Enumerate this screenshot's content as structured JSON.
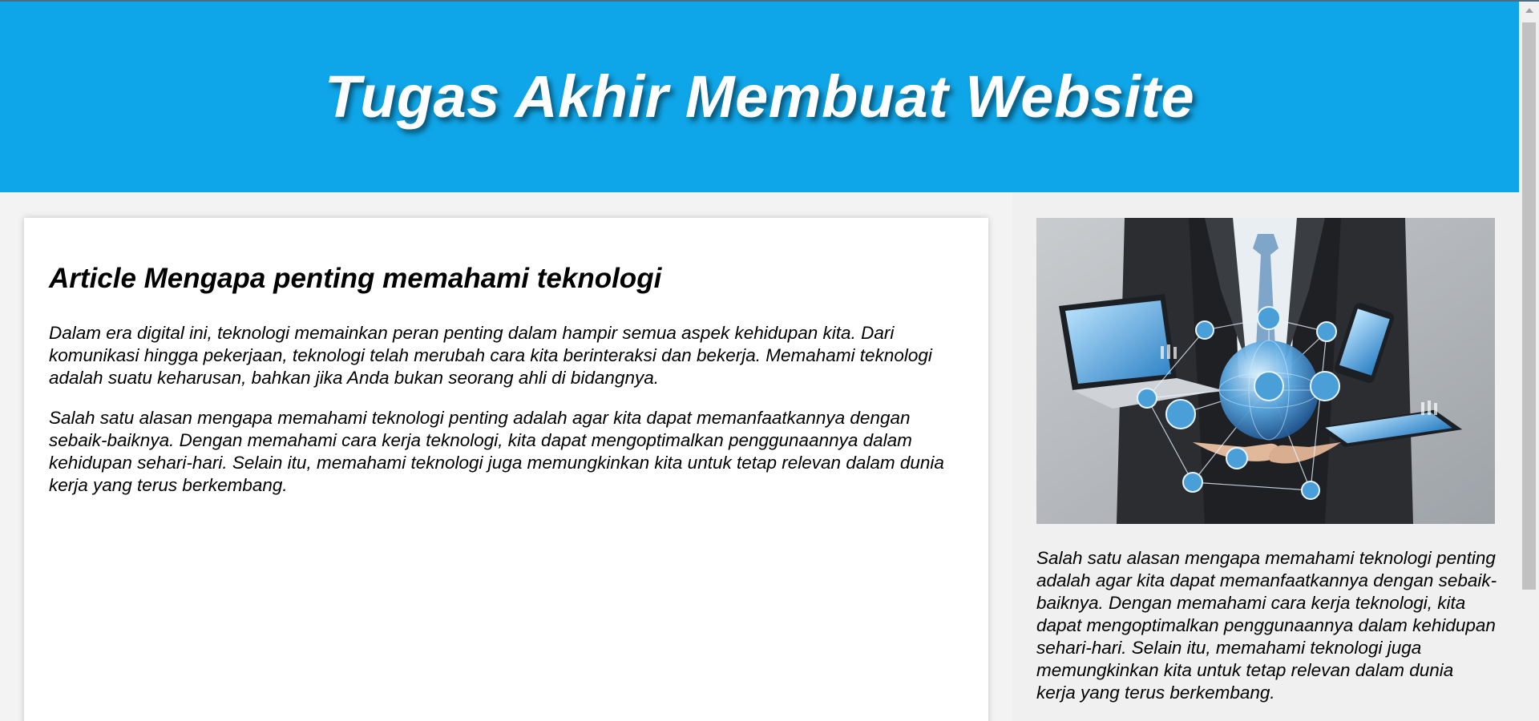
{
  "header": {
    "title": "Tugas Akhir Membuat Website"
  },
  "article": {
    "heading": "Article Mengapa penting memahami teknologi",
    "paragraphs": [
      "Dalam era digital ini, teknologi memainkan peran penting dalam hampir semua aspek kehidupan kita. Dari komunikasi hingga pekerjaan, teknologi telah merubah cara kita berinteraksi dan bekerja. Memahami teknologi adalah suatu keharusan, bahkan jika Anda bukan seorang ahli di bidangnya.",
      "Salah satu alasan mengapa memahami teknologi penting adalah agar kita dapat memanfaatkannya dengan sebaik-baiknya. Dengan memahami cara kerja teknologi, kita dapat mengoptimalkan penggunaannya dalam kehidupan sehari-hari. Selain itu, memahami teknologi juga memungkinkan kita untuk tetap relevan dalam dunia kerja yang terus berkembang."
    ]
  },
  "sidebar": {
    "image_icon": "businessman-technology-network-image",
    "text": "Salah satu alasan mengapa memahami teknologi penting adalah agar kita dapat memanfaatkannya dengan sebaik-baiknya. Dengan memahami cara kerja teknologi, kita dapat mengoptimalkan penggunaannya dalam kehidupan sehari-hari. Selain itu, memahami teknologi juga memungkinkan kita untuk tetap relevan dalam dunia kerja yang terus berkembang."
  },
  "colors": {
    "header_bg": "#0fa6e9",
    "header_text": "#ffffff",
    "page_bg": "#f3f3f3",
    "card_bg": "#ffffff"
  }
}
